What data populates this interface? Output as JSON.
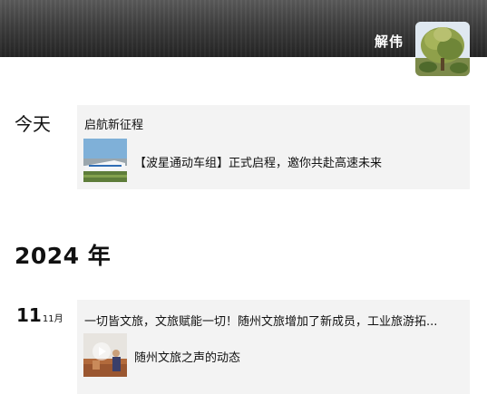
{
  "profile": {
    "name": "解伟"
  },
  "today": {
    "label": "今天",
    "post_text": "启航新征程",
    "link_text": "【波星通动车组】正式启程，邀你共赴高速未来"
  },
  "year_section": {
    "label": "2024 年"
  },
  "nov_post": {
    "day": "11",
    "month": "11月",
    "post_text": "一切皆文旅，文旅赋能一切！随州文旅增加了新成员，工业旅游拓...",
    "link_text": "随州文旅之声的动态"
  },
  "icons": {
    "avatar": "tree-photo-avatar",
    "today_thumb": "high-speed-train-thumbnail",
    "nov_thumb": "video-person-thumbnail"
  },
  "colors": {
    "cover_top": "#5b5b5b",
    "cover_bottom": "#242424",
    "card_bg": "#f3f3f3"
  }
}
